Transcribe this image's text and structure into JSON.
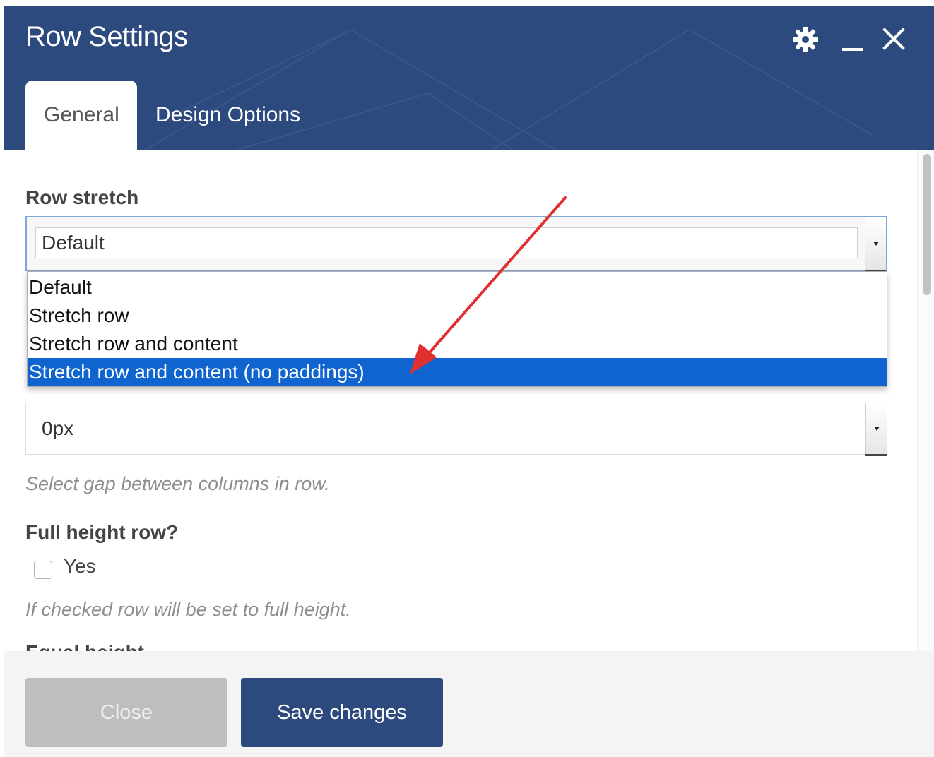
{
  "window": {
    "title": "Row Settings",
    "header_color": "#2c4a7e"
  },
  "header_icons": [
    "gear-icon",
    "minimize-icon",
    "close-icon"
  ],
  "tabs": [
    {
      "label": "General",
      "active": true
    },
    {
      "label": "Design Options",
      "active": false
    }
  ],
  "row_stretch": {
    "label": "Row stretch",
    "value": "Default",
    "options": [
      "Default",
      "Stretch row",
      "Stretch row and content",
      "Stretch row and content (no paddings)"
    ],
    "highlighted_option": "Stretch row and content (no paddings)",
    "highlight_color": "#1064d0"
  },
  "columns_gap": {
    "value": "0px",
    "help": "Select gap between columns in row."
  },
  "full_height": {
    "label": "Full height row?",
    "checkbox_label": "Yes",
    "checked": false,
    "help": "If checked row will be set to full height."
  },
  "next_field_label_partial": "Equal height",
  "footer": {
    "close_label": "Close",
    "save_label": "Save changes"
  },
  "annotation": {
    "type": "arrow",
    "color": "#e03030"
  }
}
